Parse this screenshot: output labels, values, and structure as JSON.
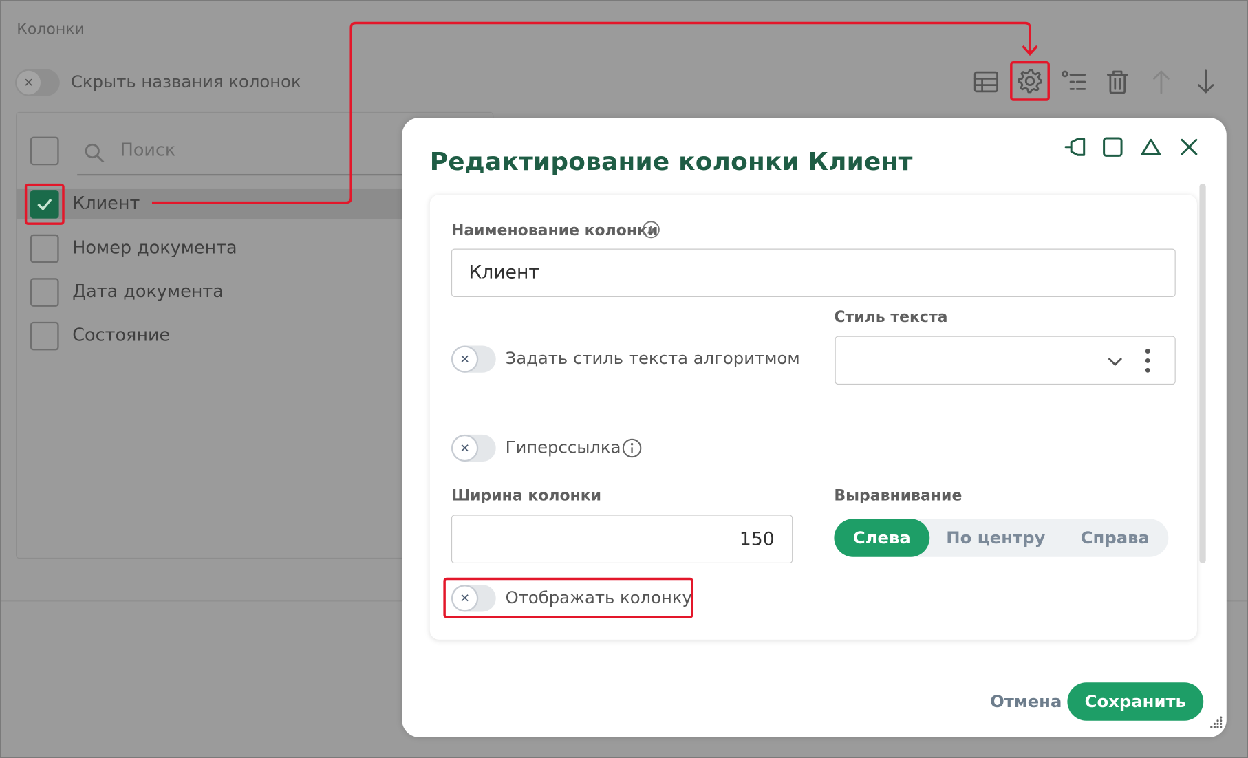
{
  "panel": {
    "title": "Колонки",
    "hide_names_label": "Скрыть названия колонок",
    "search_placeholder": "Поиск",
    "columns": [
      {
        "label": "Клиент",
        "checked": true
      },
      {
        "label": "Номер документа",
        "checked": false
      },
      {
        "label": "Дата документа",
        "checked": false
      },
      {
        "label": "Состояние",
        "checked": false
      }
    ],
    "toolbar_icons": [
      "table-icon",
      "gear-icon",
      "list-settings-icon",
      "trash-icon",
      "arrow-up-icon",
      "arrow-down-icon"
    ]
  },
  "dialog": {
    "title": "Редактирование колонки Клиент",
    "window_controls": [
      "pin-icon",
      "maximize-icon",
      "collapse-icon",
      "close-icon"
    ],
    "name_label": "Наименование колонки",
    "name_value": "Клиент",
    "style_by_algorithm_label": "Задать стиль текста алгоритмом",
    "text_style_label": "Стиль текста",
    "text_style_value": "",
    "hyperlink_label": "Гиперссылка",
    "width_label": "Ширина колонки",
    "width_value": "150",
    "alignment_label": "Выравнивание",
    "alignment_options": [
      "Слева",
      "По центру",
      "Справа"
    ],
    "alignment_selected": "Слева",
    "show_column_label": "Отображать колонку",
    "cancel_label": "Отмена",
    "save_label": "Сохранить"
  },
  "colors": {
    "accent": "#1e9e67",
    "title": "#1f5d45",
    "highlight": "#e3172a",
    "overlay": "#9b9b9b"
  }
}
